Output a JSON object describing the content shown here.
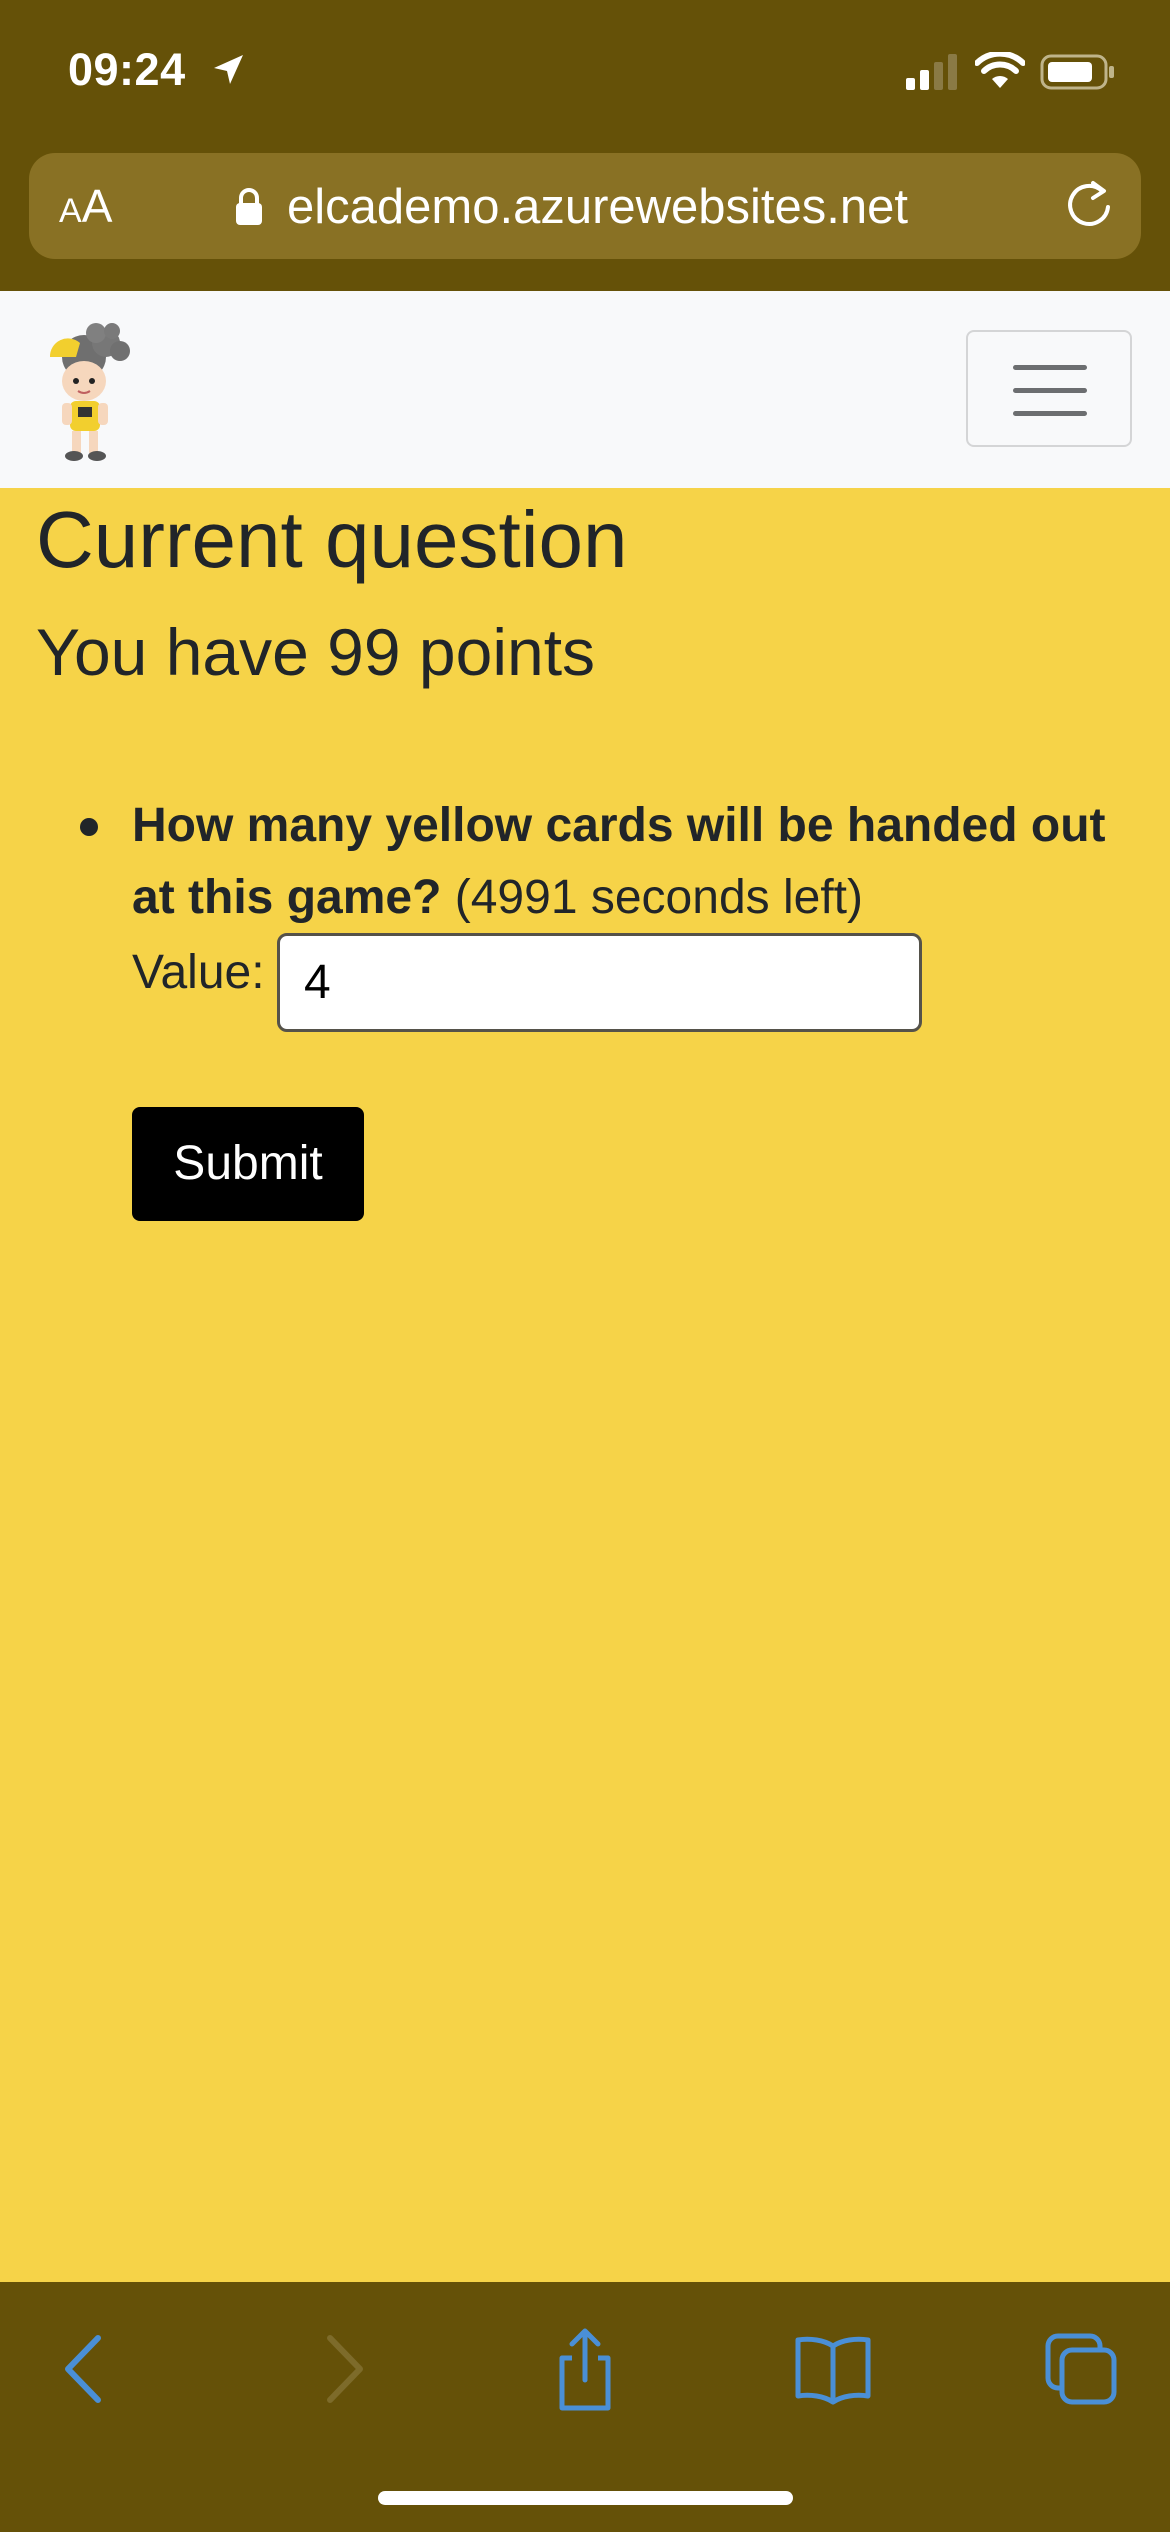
{
  "status_bar": {
    "time": "09:24",
    "icons": [
      "location-arrow-icon",
      "cellular-signal-icon",
      "wifi-icon",
      "battery-icon"
    ]
  },
  "browser": {
    "text_size_label_small": "A",
    "text_size_label_large": "A",
    "url": "elcademo.azurewebsites.net",
    "icons": [
      "lock-icon",
      "reload-icon"
    ],
    "toolbar_icons": [
      "back-icon",
      "forward-icon",
      "share-icon",
      "bookmarks-icon",
      "tabs-icon"
    ]
  },
  "navbar": {
    "logo": "cartoon-character-logo",
    "menu_icon": "hamburger-menu-icon"
  },
  "page": {
    "title": "Current question",
    "points_text": "You have 99 points",
    "question": {
      "text": "How many yellow cards will be handed out at this game?",
      "time_left": "(4991 seconds left)",
      "value_label": "Value:",
      "value": "4"
    },
    "submit_label": "Submit"
  },
  "colors": {
    "chrome_background": "#655108",
    "url_bar_background": "#897124",
    "page_background": "#f6d348",
    "navbar_background": "#f8f9fa",
    "toolbar_icon_active": "#4a8fd6",
    "toolbar_icon_disabled": "#7d6b2a",
    "submit_background": "#000000"
  }
}
